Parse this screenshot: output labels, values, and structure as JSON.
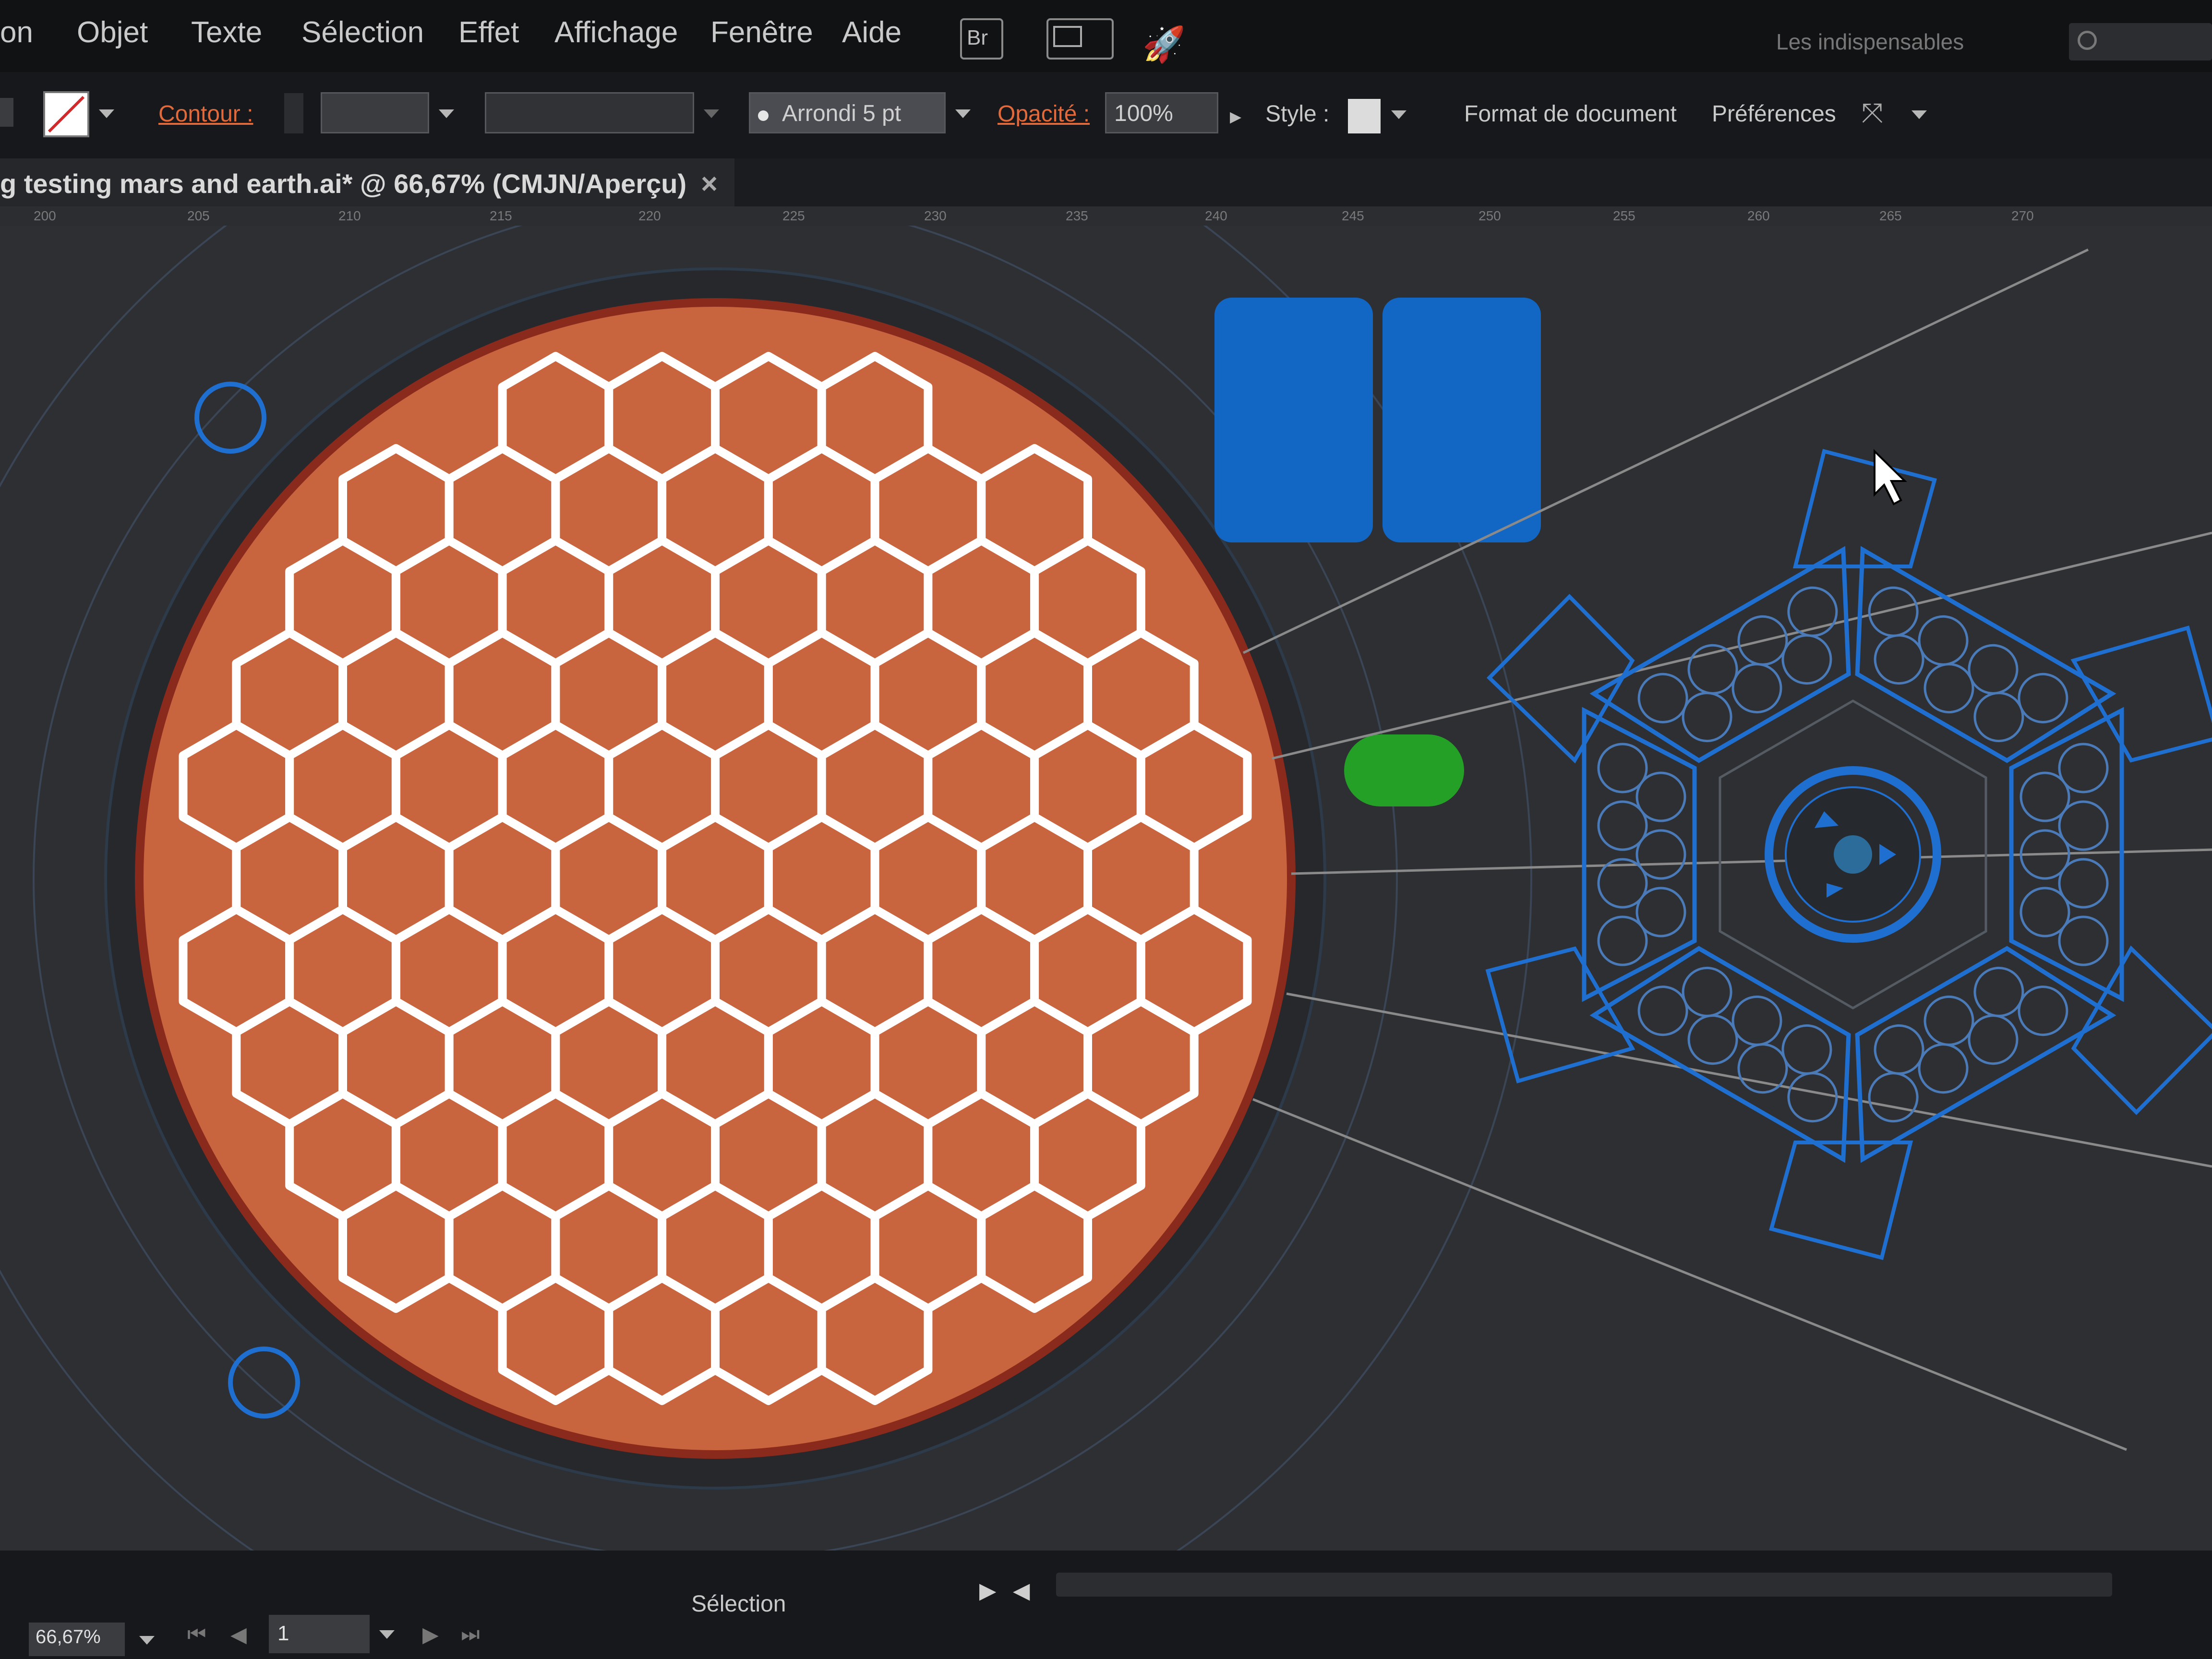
{
  "menu": {
    "items": [
      "on",
      "Objet",
      "Texte",
      "Sélection",
      "Effet",
      "Affichage",
      "Fenêtre",
      "Aide"
    ],
    "br_button": "Br",
    "workspace": "Les indispensables"
  },
  "control_bar": {
    "stroke_label": "Contour :",
    "brush_value": "Arrondi 5 pt",
    "opacity_label": "Opacité :",
    "opacity_value": "100%",
    "style_label": "Style :",
    "doc_setup_button": "Format de document",
    "preferences_button": "Préférences"
  },
  "document_tab": {
    "title": "g testing mars and earth.ai* @ 66,67% (CMJN/Aperçu)",
    "close_glyph": "×"
  },
  "ruler": {
    "ticks": [
      "200",
      "205",
      "210",
      "215",
      "220",
      "225",
      "230",
      "235",
      "240",
      "245",
      "250",
      "255",
      "260",
      "265",
      "270"
    ]
  },
  "status_bar": {
    "zoom_value": "66,67%",
    "page_value": "1",
    "tool_label": "Sélection"
  },
  "colors": {
    "planet_fill": "#c9653e",
    "hex_stroke": "#ffffff",
    "accent_blue": "#1f6fd0",
    "panel_blue": "#1266c4",
    "green_pill": "#25a027",
    "canvas_bg": "#2e2f33"
  }
}
